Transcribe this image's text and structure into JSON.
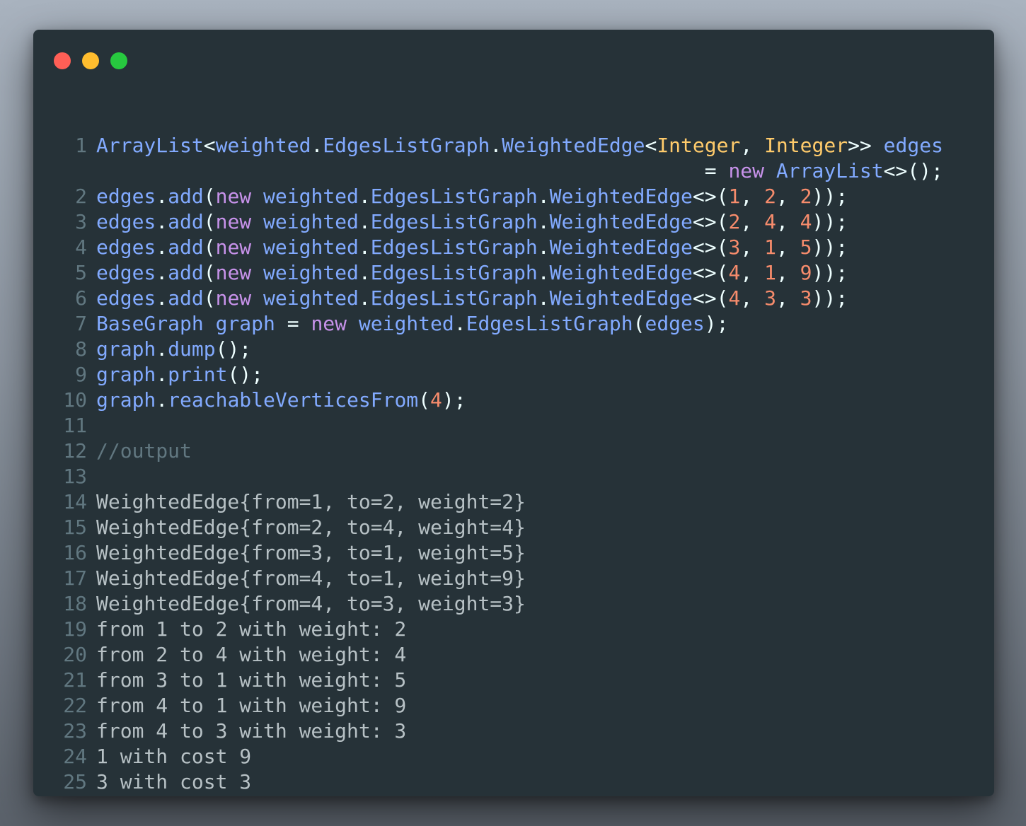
{
  "colors": {
    "window_bg": "#263238",
    "identifier": "#82aaff",
    "keyword": "#c792ea",
    "type": "#ffcb6b",
    "number": "#f78c6c",
    "punctuation": "#eeffff",
    "comment": "#617780",
    "output_text": "#b7c1c5"
  },
  "window_controls": [
    "close",
    "minimize",
    "maximize"
  ],
  "lines": [
    {
      "n": "1",
      "tokens": [
        {
          "t": "ArrayList",
          "k": "fn"
        },
        {
          "t": "<",
          "k": "p"
        },
        {
          "t": "weighted",
          "k": "fn"
        },
        {
          "t": ".",
          "k": "p"
        },
        {
          "t": "EdgesListGraph",
          "k": "fn"
        },
        {
          "t": ".",
          "k": "p"
        },
        {
          "t": "WeightedEdge",
          "k": "fn"
        },
        {
          "t": "<",
          "k": "p"
        },
        {
          "t": "Integer",
          "k": "ty"
        },
        {
          "t": ", ",
          "k": "p"
        },
        {
          "t": "Integer",
          "k": "ty"
        },
        {
          "t": ">> ",
          "k": "p"
        },
        {
          "t": "edges",
          "k": "fn"
        }
      ]
    },
    {
      "n": "",
      "pad": "                                                   ",
      "tokens": [
        {
          "t": "= ",
          "k": "p"
        },
        {
          "t": "new",
          "k": "kw"
        },
        {
          "t": " ",
          "k": "p"
        },
        {
          "t": "ArrayList",
          "k": "fn"
        },
        {
          "t": "<>();",
          "k": "p"
        }
      ]
    },
    {
      "n": "2",
      "tokens": [
        {
          "t": "edges",
          "k": "fn"
        },
        {
          "t": ".",
          "k": "p"
        },
        {
          "t": "add",
          "k": "fn"
        },
        {
          "t": "(",
          "k": "p"
        },
        {
          "t": "new",
          "k": "kw"
        },
        {
          "t": " ",
          "k": "p"
        },
        {
          "t": "weighted",
          "k": "fn"
        },
        {
          "t": ".",
          "k": "p"
        },
        {
          "t": "EdgesListGraph",
          "k": "fn"
        },
        {
          "t": ".",
          "k": "p"
        },
        {
          "t": "WeightedEdge",
          "k": "fn"
        },
        {
          "t": "<>(",
          "k": "p"
        },
        {
          "t": "1",
          "k": "num"
        },
        {
          "t": ", ",
          "k": "p"
        },
        {
          "t": "2",
          "k": "num"
        },
        {
          "t": ", ",
          "k": "p"
        },
        {
          "t": "2",
          "k": "num"
        },
        {
          "t": "));",
          "k": "p"
        }
      ]
    },
    {
      "n": "3",
      "tokens": [
        {
          "t": "edges",
          "k": "fn"
        },
        {
          "t": ".",
          "k": "p"
        },
        {
          "t": "add",
          "k": "fn"
        },
        {
          "t": "(",
          "k": "p"
        },
        {
          "t": "new",
          "k": "kw"
        },
        {
          "t": " ",
          "k": "p"
        },
        {
          "t": "weighted",
          "k": "fn"
        },
        {
          "t": ".",
          "k": "p"
        },
        {
          "t": "EdgesListGraph",
          "k": "fn"
        },
        {
          "t": ".",
          "k": "p"
        },
        {
          "t": "WeightedEdge",
          "k": "fn"
        },
        {
          "t": "<>(",
          "k": "p"
        },
        {
          "t": "2",
          "k": "num"
        },
        {
          "t": ", ",
          "k": "p"
        },
        {
          "t": "4",
          "k": "num"
        },
        {
          "t": ", ",
          "k": "p"
        },
        {
          "t": "4",
          "k": "num"
        },
        {
          "t": "));",
          "k": "p"
        }
      ]
    },
    {
      "n": "4",
      "tokens": [
        {
          "t": "edges",
          "k": "fn"
        },
        {
          "t": ".",
          "k": "p"
        },
        {
          "t": "add",
          "k": "fn"
        },
        {
          "t": "(",
          "k": "p"
        },
        {
          "t": "new",
          "k": "kw"
        },
        {
          "t": " ",
          "k": "p"
        },
        {
          "t": "weighted",
          "k": "fn"
        },
        {
          "t": ".",
          "k": "p"
        },
        {
          "t": "EdgesListGraph",
          "k": "fn"
        },
        {
          "t": ".",
          "k": "p"
        },
        {
          "t": "WeightedEdge",
          "k": "fn"
        },
        {
          "t": "<>(",
          "k": "p"
        },
        {
          "t": "3",
          "k": "num"
        },
        {
          "t": ", ",
          "k": "p"
        },
        {
          "t": "1",
          "k": "num"
        },
        {
          "t": ", ",
          "k": "p"
        },
        {
          "t": "5",
          "k": "num"
        },
        {
          "t": "));",
          "k": "p"
        }
      ]
    },
    {
      "n": "5",
      "tokens": [
        {
          "t": "edges",
          "k": "fn"
        },
        {
          "t": ".",
          "k": "p"
        },
        {
          "t": "add",
          "k": "fn"
        },
        {
          "t": "(",
          "k": "p"
        },
        {
          "t": "new",
          "k": "kw"
        },
        {
          "t": " ",
          "k": "p"
        },
        {
          "t": "weighted",
          "k": "fn"
        },
        {
          "t": ".",
          "k": "p"
        },
        {
          "t": "EdgesListGraph",
          "k": "fn"
        },
        {
          "t": ".",
          "k": "p"
        },
        {
          "t": "WeightedEdge",
          "k": "fn"
        },
        {
          "t": "<>(",
          "k": "p"
        },
        {
          "t": "4",
          "k": "num"
        },
        {
          "t": ", ",
          "k": "p"
        },
        {
          "t": "1",
          "k": "num"
        },
        {
          "t": ", ",
          "k": "p"
        },
        {
          "t": "9",
          "k": "num"
        },
        {
          "t": "));",
          "k": "p"
        }
      ]
    },
    {
      "n": "6",
      "tokens": [
        {
          "t": "edges",
          "k": "fn"
        },
        {
          "t": ".",
          "k": "p"
        },
        {
          "t": "add",
          "k": "fn"
        },
        {
          "t": "(",
          "k": "p"
        },
        {
          "t": "new",
          "k": "kw"
        },
        {
          "t": " ",
          "k": "p"
        },
        {
          "t": "weighted",
          "k": "fn"
        },
        {
          "t": ".",
          "k": "p"
        },
        {
          "t": "EdgesListGraph",
          "k": "fn"
        },
        {
          "t": ".",
          "k": "p"
        },
        {
          "t": "WeightedEdge",
          "k": "fn"
        },
        {
          "t": "<>(",
          "k": "p"
        },
        {
          "t": "4",
          "k": "num"
        },
        {
          "t": ", ",
          "k": "p"
        },
        {
          "t": "3",
          "k": "num"
        },
        {
          "t": ", ",
          "k": "p"
        },
        {
          "t": "3",
          "k": "num"
        },
        {
          "t": "));",
          "k": "p"
        }
      ]
    },
    {
      "n": "7",
      "tokens": [
        {
          "t": "BaseGraph graph ",
          "k": "fn"
        },
        {
          "t": "= ",
          "k": "p"
        },
        {
          "t": "new",
          "k": "kw"
        },
        {
          "t": " ",
          "k": "p"
        },
        {
          "t": "weighted",
          "k": "fn"
        },
        {
          "t": ".",
          "k": "p"
        },
        {
          "t": "EdgesListGraph",
          "k": "fn"
        },
        {
          "t": "(",
          "k": "p"
        },
        {
          "t": "edges",
          "k": "fn"
        },
        {
          "t": ");",
          "k": "p"
        }
      ]
    },
    {
      "n": "8",
      "tokens": [
        {
          "t": "graph",
          "k": "fn"
        },
        {
          "t": ".",
          "k": "p"
        },
        {
          "t": "dump",
          "k": "fn"
        },
        {
          "t": "();",
          "k": "p"
        }
      ]
    },
    {
      "n": "9",
      "tokens": [
        {
          "t": "graph",
          "k": "fn"
        },
        {
          "t": ".",
          "k": "p"
        },
        {
          "t": "print",
          "k": "fn"
        },
        {
          "t": "();",
          "k": "p"
        }
      ]
    },
    {
      "n": "10",
      "tokens": [
        {
          "t": "graph",
          "k": "fn"
        },
        {
          "t": ".",
          "k": "p"
        },
        {
          "t": "reachableVerticesFrom",
          "k": "fn"
        },
        {
          "t": "(",
          "k": "p"
        },
        {
          "t": "4",
          "k": "num"
        },
        {
          "t": ");",
          "k": "p"
        }
      ]
    },
    {
      "n": "11",
      "tokens": []
    },
    {
      "n": "12",
      "tokens": [
        {
          "t": "//output",
          "k": "cm"
        }
      ]
    },
    {
      "n": "13",
      "tokens": []
    },
    {
      "n": "14",
      "tokens": [
        {
          "t": "WeightedEdge{from=1, to=2, weight=2}",
          "k": "out"
        }
      ]
    },
    {
      "n": "15",
      "tokens": [
        {
          "t": "WeightedEdge{from=2, to=4, weight=4}",
          "k": "out"
        }
      ]
    },
    {
      "n": "16",
      "tokens": [
        {
          "t": "WeightedEdge{from=3, to=1, weight=5}",
          "k": "out"
        }
      ]
    },
    {
      "n": "17",
      "tokens": [
        {
          "t": "WeightedEdge{from=4, to=1, weight=9}",
          "k": "out"
        }
      ]
    },
    {
      "n": "18",
      "tokens": [
        {
          "t": "WeightedEdge{from=4, to=3, weight=3}",
          "k": "out"
        }
      ]
    },
    {
      "n": "19",
      "tokens": [
        {
          "t": "from 1 to 2 with weight: 2",
          "k": "out"
        }
      ]
    },
    {
      "n": "20",
      "tokens": [
        {
          "t": "from 2 to 4 with weight: 4",
          "k": "out"
        }
      ]
    },
    {
      "n": "21",
      "tokens": [
        {
          "t": "from 3 to 1 with weight: 5",
          "k": "out"
        }
      ]
    },
    {
      "n": "22",
      "tokens": [
        {
          "t": "from 4 to 1 with weight: 9",
          "k": "out"
        }
      ]
    },
    {
      "n": "23",
      "tokens": [
        {
          "t": "from 4 to 3 with weight: 3",
          "k": "out"
        }
      ]
    },
    {
      "n": "24",
      "tokens": [
        {
          "t": "1 with cost 9",
          "k": "out"
        }
      ]
    },
    {
      "n": "25",
      "tokens": [
        {
          "t": "3 with cost 3",
          "k": "out"
        }
      ]
    }
  ]
}
